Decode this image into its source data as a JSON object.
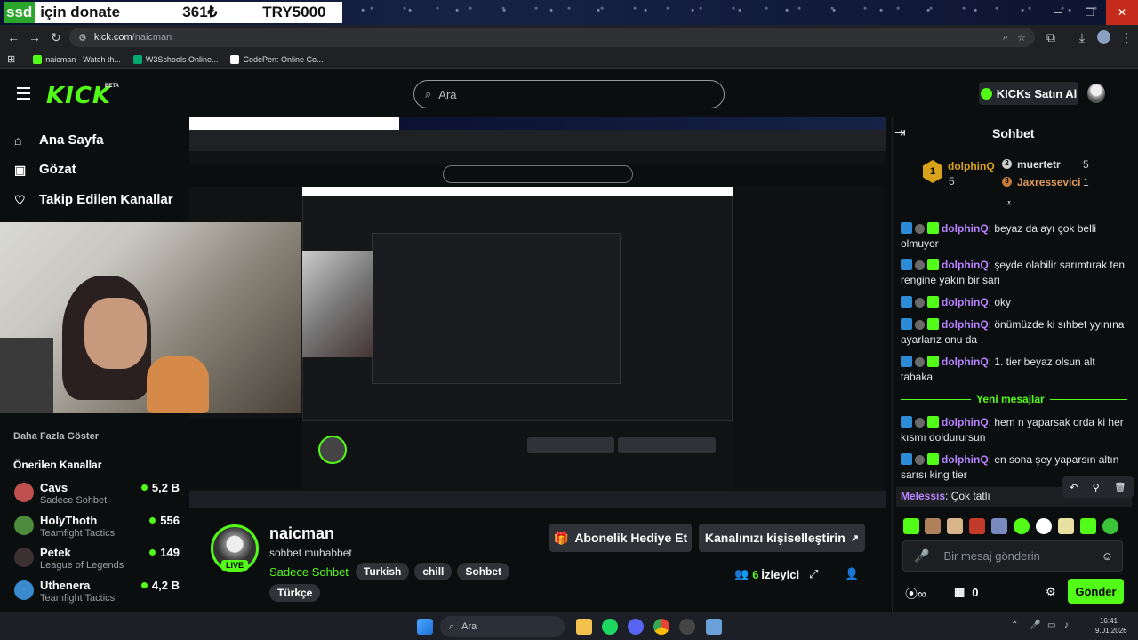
{
  "overlay": {
    "ssd": "ssd",
    "donate_text": "için donate",
    "amount": "361₺",
    "goal": "TRY5000"
  },
  "browser": {
    "url_host": "kick.com",
    "url_path": "/naicman",
    "bookmarks": [
      "naicman - Watch th...",
      "W3Schools Online...",
      "CodePen: Online Co..."
    ]
  },
  "header": {
    "logo": "KICK",
    "beta": "BETA",
    "search_placeholder": "Ara",
    "buy_kicks": "KICKs Satın Al"
  },
  "sidebar": {
    "nav": [
      "Ana Sayfa",
      "Gözat",
      "Takip Edilen Kanallar"
    ],
    "show_more": "Daha Fazla Göster",
    "recommended_title": "Önerilen Kanallar",
    "channels": [
      {
        "name": "Cavs",
        "category": "Sadece Sohbet",
        "viewers": "5,2 B"
      },
      {
        "name": "HolyThoth",
        "category": "Teamfight Tactics",
        "viewers": "556"
      },
      {
        "name": "Petek",
        "category": "League of Legends",
        "viewers": "149"
      },
      {
        "name": "Uthenera",
        "category": "Teamfight Tactics",
        "viewers": "4,2 B"
      }
    ]
  },
  "channel": {
    "name": "naicman",
    "title": "sohbet muhabbet",
    "category": "Sadece Sohbet",
    "tags": [
      "Turkish",
      "chill",
      "Sohbet"
    ],
    "language": "Türkçe",
    "live": "LIVE",
    "gift_sub": "Abonelik Hediye Et",
    "customize": "Kanalınızı kişiselleştirin",
    "viewers_count": "6",
    "viewers_label": "İzleyici"
  },
  "chat": {
    "title": "Sohbet",
    "top_gifters": [
      {
        "rank": "1",
        "name": "dolphinQ",
        "count": "5"
      },
      {
        "rank": "2",
        "name": "muertetr",
        "count": "5"
      },
      {
        "rank": "3",
        "name": "Jaxressevici",
        "count": "1"
      }
    ],
    "messages": [
      {
        "user": "dolphinQ",
        "text": "beyaz da ayı çok belli olmuyor"
      },
      {
        "user": "dolphinQ",
        "text": "şeyde olabilir sarımtırak ten rengine yakın bir sarı"
      },
      {
        "user": "dolphinQ",
        "text": "oky"
      },
      {
        "user": "dolphinQ",
        "text": "önümüzde ki sıhbet yyınına ayarlarız onu da"
      },
      {
        "user": "dolphinQ",
        "text": "1. tier beyaz olsun alt tabaka"
      }
    ],
    "new_messages": "Yeni mesajlar",
    "new_msgs": [
      {
        "user": "dolphinQ",
        "text": "hem n yaparsak orda ki her kısmı doldurursun"
      },
      {
        "user": "dolphinQ",
        "text": "en sona şey yaparsın altın sarısı king tier"
      }
    ],
    "last": {
      "user": "Melessis",
      "text": "Çok tatlı"
    },
    "input_placeholder": "Bir mesaj gönderin",
    "points": "0",
    "send": "Gönder"
  },
  "taskbar": {
    "search": "Ara",
    "time": "16:41",
    "date": "9.01.2026"
  },
  "colors": {
    "brand": "#53fc18",
    "username": "#b884ff"
  }
}
